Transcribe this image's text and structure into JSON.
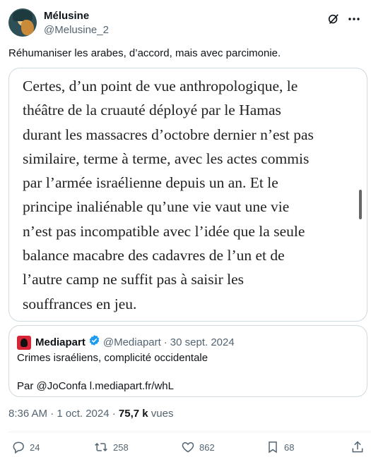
{
  "author": {
    "display_name": "Mélusine",
    "handle": "@Melusine_2"
  },
  "tweet": {
    "text": "Réhumaniser les arabes, d’accord, mais avec parcimonie."
  },
  "media": {
    "lines": [
      "Certes, d’un point de vue anthropologique, le",
      "théâtre de la cruauté déployé par le Hamas",
      "durant les massacres d’octobre dernier n’est pas",
      "similaire, terme à terme, avec les actes commis",
      "par l’armée israélienne depuis un an. Et le",
      "principe inaliénable qu’une vie vaut une vie",
      "n’est pas incompatible avec l’idée que la seule",
      "balance macabre des cadavres de l’un et de",
      "l’autre camp ne suffit pas à saisir les",
      "souffrances en jeu."
    ]
  },
  "quote": {
    "name": "Mediapart",
    "handle": "@Mediapart",
    "separator": "·",
    "date": "30 sept. 2024",
    "line1": "Crimes israéliens, complicité occidentale",
    "line2": "Par @JoConfa  l.mediapart.fr/whL",
    "logo_color": "#d72436"
  },
  "meta": {
    "time": "8:36 AM · 1 oct. 2024 · ",
    "views_count": "75,7 k",
    "views_label": " vues"
  },
  "actions": {
    "replies": "24",
    "retweets": "258",
    "likes": "862",
    "bookmarks": "68"
  },
  "icons": {
    "header": [
      "grok-icon",
      "more-icon"
    ],
    "actions": [
      "reply-icon",
      "retweet-icon",
      "like-icon",
      "bookmark-icon",
      "share-icon"
    ]
  },
  "colors": {
    "verified": "#1d9bf0",
    "secondary_text": "#536471",
    "border": "#cfd9de"
  }
}
